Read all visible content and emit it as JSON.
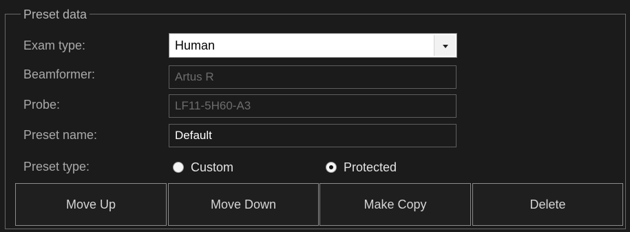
{
  "group": {
    "title": "Preset data"
  },
  "fields": {
    "exam_type": {
      "label": "Exam type:",
      "value": "Human"
    },
    "beamformer": {
      "label": "Beamformer:",
      "value": "Artus R"
    },
    "probe": {
      "label": "Probe:",
      "value": "LF11-5H60-A3"
    },
    "preset_name": {
      "label": "Preset name:",
      "value": "Default"
    },
    "preset_type": {
      "label": "Preset type:",
      "options": [
        "Custom",
        "Protected"
      ],
      "selected": "Protected"
    }
  },
  "buttons": {
    "move_up": "Move Up",
    "move_down": "Move Down",
    "make_copy": "Make Copy",
    "delete": "Delete"
  },
  "colors": {
    "background": "#1b1b1b",
    "border": "#6a6a6a",
    "label": "#a9a9a9",
    "disabled_text": "#6d6d6d",
    "combo_background": "#ffffff"
  },
  "icons": {
    "combo_arrow": "chevron-down-icon",
    "radio_unchecked": "radio-unchecked-icon",
    "radio_checked": "radio-checked-icon"
  }
}
